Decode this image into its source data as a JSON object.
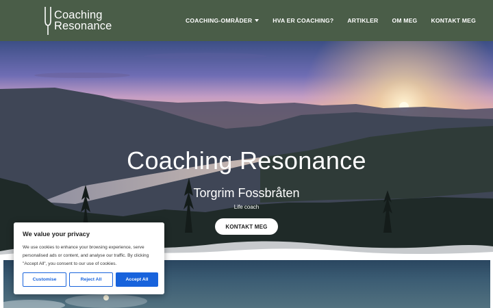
{
  "header": {
    "logo": {
      "line1": "Coaching",
      "line2": "Resonance",
      "icon": "tuning-fork-icon"
    },
    "nav": [
      {
        "label": "COACHING-OMRÅDER",
        "has_dropdown": true
      },
      {
        "label": "HVA ER COACHING?"
      },
      {
        "label": "ARTIKLER"
      },
      {
        "label": "OM MEG"
      },
      {
        "label": "KONTAKT MEG"
      }
    ]
  },
  "hero": {
    "title": "Coaching Resonance",
    "subtitle": "Torgrim Fossbråten",
    "tagline": "Life coach",
    "cta": "KONTAKT MEG"
  },
  "cookie_banner": {
    "title": "We value your privacy",
    "text": "We use cookies to enhance your browsing experience, serve personalised ads or content, and analyse our traffic. By clicking \"Accept All\", you consent to our use of cookies.",
    "buttons": {
      "customise": "Customise",
      "reject": "Reject All",
      "accept": "Accept All"
    },
    "accent_color": "#1863dc"
  },
  "colors": {
    "header_bg": "#4a5d48"
  }
}
